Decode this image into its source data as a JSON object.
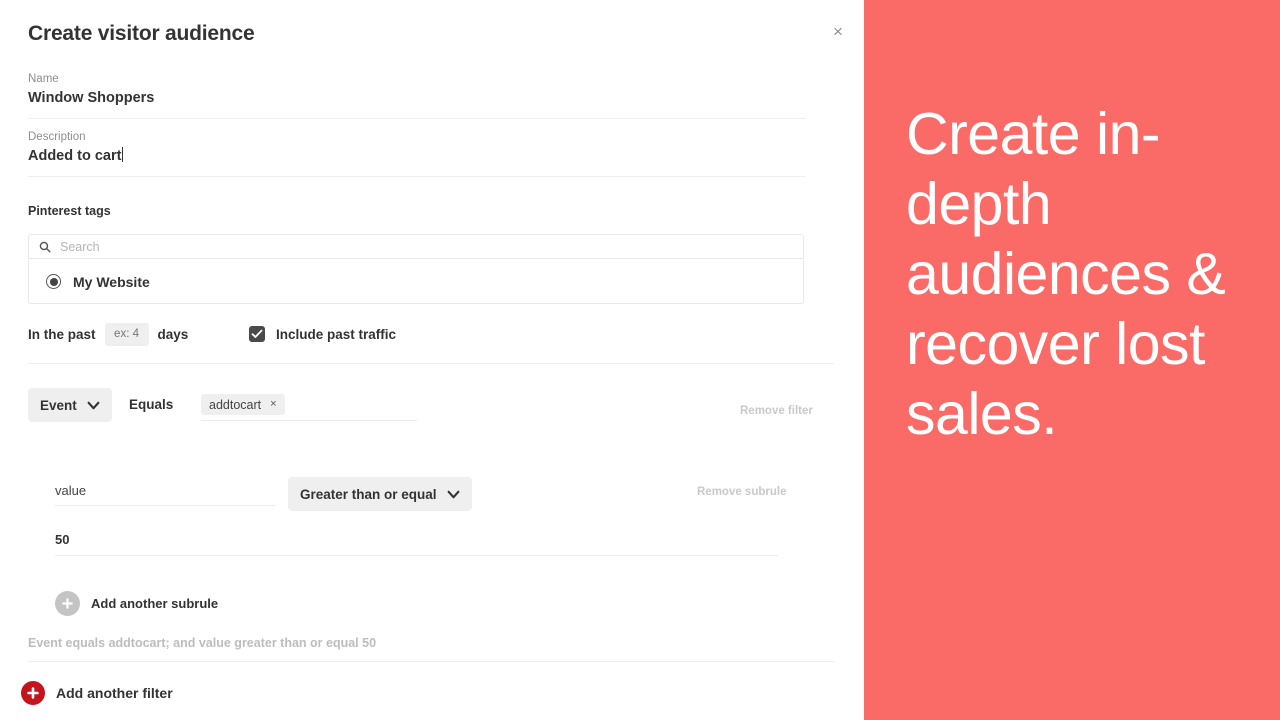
{
  "dialog": {
    "title": "Create visitor audience",
    "close_icon": "close-icon",
    "close_label": "×"
  },
  "fields": {
    "name": {
      "label": "Name",
      "value": "Window Shoppers"
    },
    "description": {
      "label": "Description",
      "value": "Added to cart"
    }
  },
  "tags": {
    "section_label": "Pinterest tags",
    "search_placeholder": "Search",
    "search_value": "",
    "search_icon": "search-icon",
    "options": [
      {
        "label": "My Website",
        "selected": true
      }
    ]
  },
  "timeframe": {
    "prefix_label": "In the past",
    "days_placeholder": "ex: 4",
    "days_value": "",
    "suffix_label": "days",
    "include_past_traffic": {
      "label": "Include past traffic",
      "checked": true
    }
  },
  "filter": {
    "field_dropdown": "Event",
    "field_dropdown_icon": "chevron-down-icon",
    "operator_label": "Equals",
    "tokens": [
      {
        "label": "addtocart",
        "remove_icon": "close-icon",
        "remove_label": "×"
      }
    ],
    "remove_filter_label": "Remove filter",
    "subrule": {
      "key_value": "value",
      "operator_dropdown": "Greater than or equal",
      "operator_dropdown_icon": "chevron-down-icon",
      "number_value": "50",
      "remove_subrule_label": "Remove subrule"
    },
    "add_subrule_label": "Add another subrule",
    "add_subrule_icon": "plus-icon",
    "summary": "Event equals addtocart; and value greater than or equal 50"
  },
  "footer": {
    "add_filter_label": "Add another filter",
    "add_filter_icon": "plus-icon"
  },
  "promo": {
    "headline": "Create in-depth audiences & recover lost sales.",
    "background_color": "#FA6A66",
    "text_color": "#FFFFFF"
  }
}
